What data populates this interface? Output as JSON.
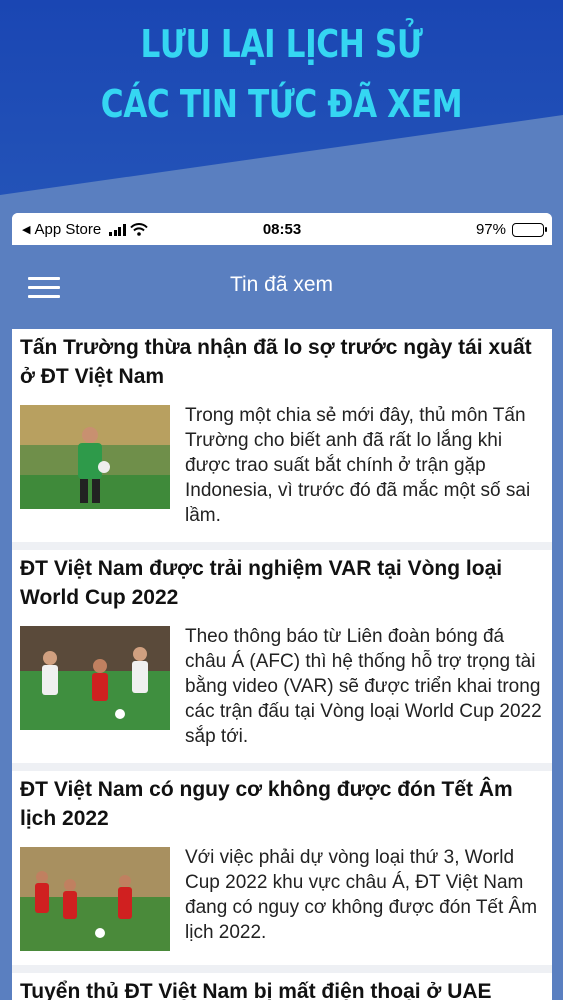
{
  "hero": {
    "line1": "LƯU LẠI LỊCH SỬ",
    "line2": "CÁC TIN TỨC ĐÃ XEM"
  },
  "status_bar": {
    "back_app": "App Store",
    "time": "08:53",
    "battery": "97%",
    "battery_level": 0.97
  },
  "navbar": {
    "title": "Tin đã xem",
    "menu_icon": "hamburger-icon"
  },
  "articles": [
    {
      "title": "Tấn Trường thừa nhận đã lo sợ trước ngày tái xuất ở ĐT Việt Nam",
      "summary": "Trong một chia sẻ mới đây, thủ môn Tấn Trường cho biết anh đã rất lo lắng khi được trao suất bắt chính ở trận gặp Indonesia, vì trước đó đã mắc một số sai lầm."
    },
    {
      "title": "ĐT Việt Nam được trải nghiệm VAR tại Vòng loại World Cup 2022",
      "summary": "Theo thông báo từ Liên đoàn bóng đá châu Á (AFC) thì hệ thống hỗ trợ trọng tài bằng video (VAR) sẽ được triển khai trong các trận đấu tại Vòng loại World Cup 2022 sắp tới."
    },
    {
      "title": "ĐT Việt Nam có nguy cơ không được đón Tết Âm lịch 2022",
      "summary": "Với việc phải dự vòng loại thứ 3, World Cup 2022 khu vực châu Á, ĐT Việt Nam đang có nguy cơ không được đón Tết Âm lịch 2022."
    },
    {
      "title": "Tuyển thủ ĐT Việt Nam bị mất điện thoại ở UAE",
      "summary": ""
    }
  ],
  "colors": {
    "hero_bg": "#1a46b3",
    "hero_text": "#35d6f2",
    "navbar_bg": "#5a7fc0"
  }
}
